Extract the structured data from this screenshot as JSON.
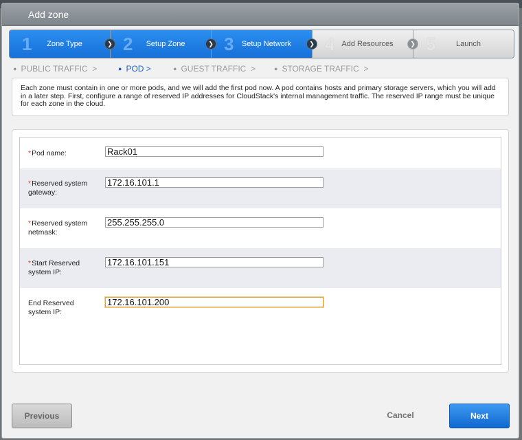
{
  "dialog": {
    "title": "Add zone"
  },
  "steps": [
    {
      "num": "1",
      "label": "Zone Type",
      "state": "active"
    },
    {
      "num": "2",
      "label": "Setup Zone",
      "state": "active"
    },
    {
      "num": "3",
      "label": "Setup Network",
      "state": "active"
    },
    {
      "num": "4",
      "label": "Add Resources",
      "state": "inactive"
    },
    {
      "num": "5",
      "label": "Launch",
      "state": "inactive"
    }
  ],
  "subnav": [
    {
      "label": "PUBLIC TRAFFIC",
      "suffix": ">",
      "active": false
    },
    {
      "label": "POD",
      "suffix": ">",
      "active": true
    },
    {
      "label": "GUEST TRAFFIC",
      "suffix": ">",
      "active": false
    },
    {
      "label": "STORAGE TRAFFIC",
      "suffix": ">",
      "active": false
    }
  ],
  "info": {
    "text": "Each zone must contain in one or more pods, and we will add the first pod now. A pod contains hosts and primary storage servers, which you will add in a later step. First, configure a range of reserved IP addresses for CloudStack's internal management traffic. The reserved IP range must be unique for each zone in the cloud."
  },
  "form": {
    "fields": [
      {
        "label_line1": "Pod name:",
        "label_line2": "",
        "required": true,
        "value": "Rack01"
      },
      {
        "label_line1": "Reserved system",
        "label_line2": "gateway:",
        "required": true,
        "value": "172.16.101.1"
      },
      {
        "label_line1": "Reserved system",
        "label_line2": "netmask:",
        "required": true,
        "value": "255.255.255.0"
      },
      {
        "label_line1": "Start Reserved",
        "label_line2": "system IP:",
        "required": true,
        "value": "172.16.101.151"
      },
      {
        "label_line1": "End Reserved",
        "label_line2": "system IP:",
        "required": false,
        "value": "172.16.101.200"
      }
    ],
    "required_marker": "*"
  },
  "footer": {
    "previous_label": "Previous",
    "cancel_label": "Cancel",
    "next_label": "Next"
  },
  "colors": {
    "accent": "#1670d8",
    "required": "#e03a2f",
    "focus_border": "#d9a441"
  }
}
